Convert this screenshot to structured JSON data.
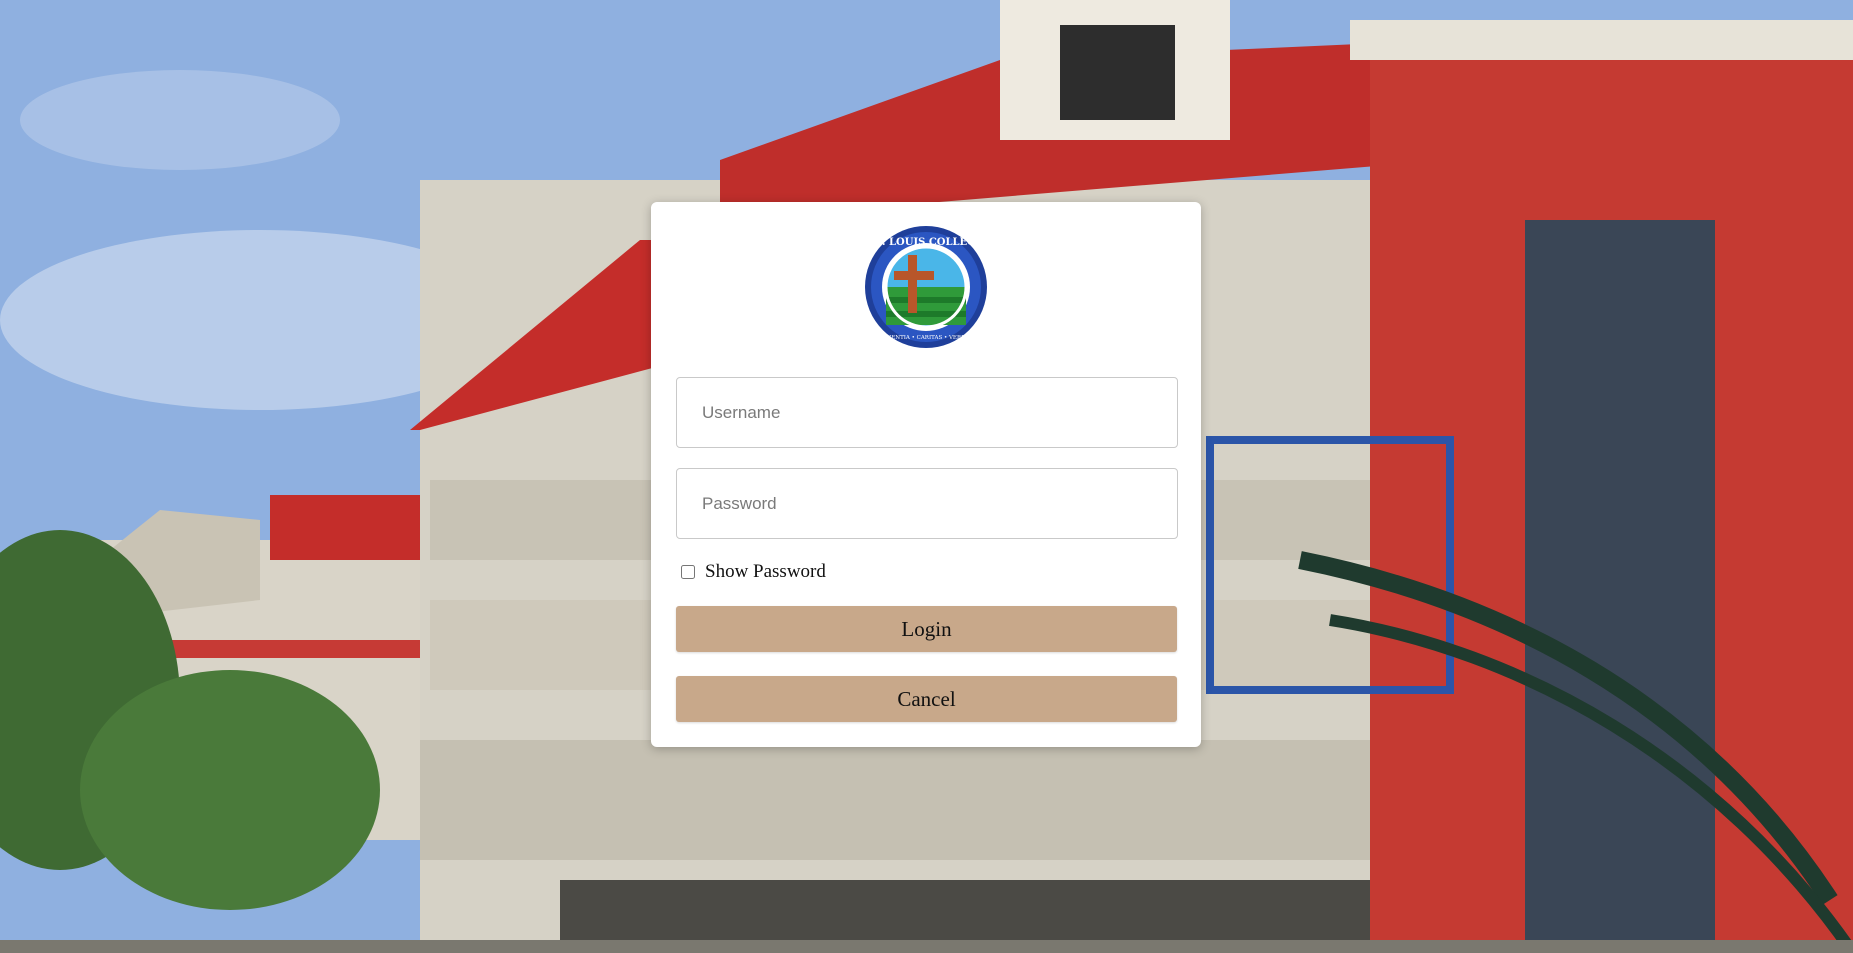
{
  "login": {
    "logo": {
      "icon": "school-seal-logo",
      "name_text": "ST. LOUIS COLLEGE",
      "motto_text": "SAPIENTIA • CARITAS • VERITAS",
      "colors": {
        "ring": "#1f3f9a",
        "inner": "#2f9a3a",
        "sky": "#4ab6e8",
        "cross": "#b8562a"
      }
    },
    "username": {
      "placeholder": "Username",
      "value": ""
    },
    "password": {
      "placeholder": "Password",
      "value": ""
    },
    "show_password": {
      "label": "Show Password",
      "checked": false
    },
    "login_button": "Login",
    "cancel_button": "Cancel"
  },
  "theme": {
    "button_color": "#c8a88a",
    "card_color": "#ffffff"
  }
}
